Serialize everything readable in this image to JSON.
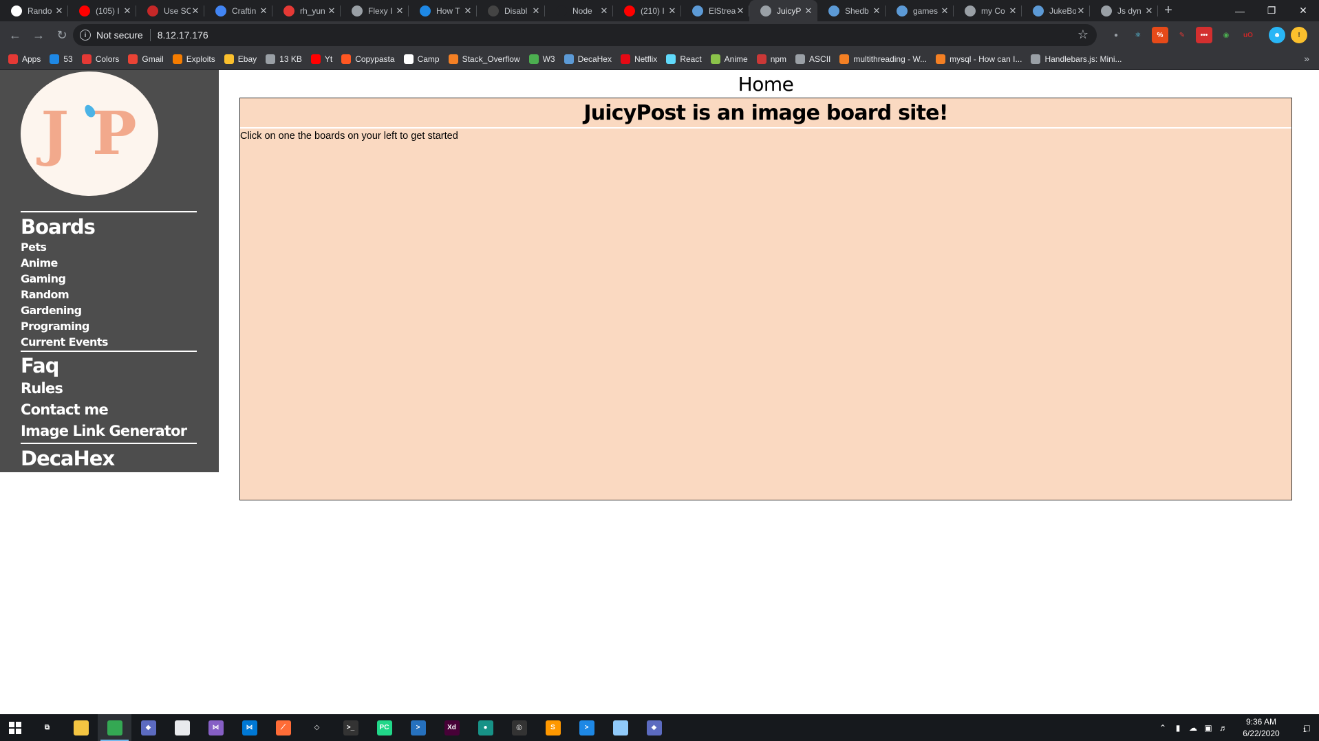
{
  "browser": {
    "tabs": [
      {
        "title": "Rando",
        "icon": "generic-icon",
        "color": "#ffffff"
      },
      {
        "title": "(105) I",
        "icon": "youtube-icon",
        "color": "#ff0000"
      },
      {
        "title": "Use SC",
        "icon": "shield-icon",
        "color": "#c62828"
      },
      {
        "title": "Craftin",
        "icon": "bracket-icon",
        "color": "#4285f4"
      },
      {
        "title": "rh_yun",
        "icon": "hat-icon",
        "color": "#e53935"
      },
      {
        "title": "Flexy I",
        "icon": "globe-icon",
        "color": "#9aa0a6"
      },
      {
        "title": "How T",
        "icon": "refresh-icon",
        "color": "#1e88e5"
      },
      {
        "title": "Disabl",
        "icon": "pin-icon",
        "color": "#444444"
      },
      {
        "title": "Node",
        "icon": "node-icon",
        "color": "#202124"
      },
      {
        "title": "(210) I",
        "icon": "youtube-icon",
        "color": "#ff0000"
      },
      {
        "title": "ElStrea",
        "icon": "monitor-icon",
        "color": "#5c9ad6"
      },
      {
        "title": "JuicyP",
        "icon": "globe-icon",
        "color": "#9aa0a6",
        "active": true
      },
      {
        "title": "Shedb",
        "icon": "monitor-icon",
        "color": "#5c9ad6"
      },
      {
        "title": "games",
        "icon": "monitor-icon",
        "color": "#5c9ad6"
      },
      {
        "title": "my Co",
        "icon": "globe-icon",
        "color": "#9aa0a6"
      },
      {
        "title": "JukeBo",
        "icon": "monitor-icon",
        "color": "#5c9ad6"
      },
      {
        "title": "Js dyn",
        "icon": "globe-icon",
        "color": "#9aa0a6"
      }
    ],
    "new_tab": "+",
    "address": {
      "security": "Not secure",
      "url": "8.12.17.176"
    },
    "bookmarks": [
      {
        "label": "Apps",
        "color": "#e53935"
      },
      {
        "label": "53",
        "color": "#1e88e5"
      },
      {
        "label": "Colors",
        "color": "#e53935"
      },
      {
        "label": "Gmail",
        "color": "#ea4335"
      },
      {
        "label": "Exploits",
        "color": "#f57c00"
      },
      {
        "label": "Ebay",
        "color": "#fbc02d"
      },
      {
        "label": "13 KB",
        "color": "#9aa0a6"
      },
      {
        "label": "Yt",
        "color": "#ff0000"
      },
      {
        "label": "Copypasta",
        "color": "#ff5722"
      },
      {
        "label": "Camp",
        "color": "#ffffff"
      },
      {
        "label": "Stack_Overflow",
        "color": "#f48024"
      },
      {
        "label": "W3",
        "color": "#4caf50"
      },
      {
        "label": "DecaHex",
        "color": "#5c9ad6"
      },
      {
        "label": "Netflix",
        "color": "#e50914"
      },
      {
        "label": "React",
        "color": "#61dafb"
      },
      {
        "label": "Anime",
        "color": "#8bc34a"
      },
      {
        "label": "npm",
        "color": "#cb3837"
      },
      {
        "label": "ASCII",
        "color": "#9aa0a6"
      },
      {
        "label": "multithreading - W...",
        "color": "#f48024"
      },
      {
        "label": "mysql - How can I...",
        "color": "#f48024"
      },
      {
        "label": "Handlebars.js: Mini...",
        "color": "#9aa0a6"
      }
    ]
  },
  "site": {
    "logo_text": "J P",
    "sections": {
      "boards_heading": "Boards",
      "boards": [
        "Pets",
        "Anime",
        "Gaming",
        "Random",
        "Gardening",
        "Programing",
        "Current Events"
      ],
      "faq_heading": "Faq",
      "links": [
        "Rules",
        "Contact me",
        "Image Link Generator"
      ],
      "footer_heading": "DecaHex"
    },
    "page_title": "Home",
    "main_heading": "JuicyPost is an image board site!",
    "main_text": "Click on one the boards on your left to get started",
    "colors": {
      "sidebar": "#4d4d4d",
      "panel": "#fad9c1",
      "logo": "#f2a98c"
    }
  },
  "taskbar": {
    "apps": [
      {
        "name": "task-view-icon",
        "color": "#16191d",
        "glyph": "⧉"
      },
      {
        "name": "file-explorer-icon",
        "color": "#f4c542",
        "glyph": ""
      },
      {
        "name": "chrome-icon",
        "color": "#34a853",
        "glyph": "",
        "active": true
      },
      {
        "name": "git-icon",
        "color": "#5c6bc0",
        "glyph": "◆"
      },
      {
        "name": "notepad-icon",
        "color": "#e8eaed",
        "glyph": ""
      },
      {
        "name": "visual-studio-icon",
        "color": "#865fc5",
        "glyph": "⋈"
      },
      {
        "name": "vscode-icon",
        "color": "#0078d4",
        "glyph": "⋈"
      },
      {
        "name": "postman-icon",
        "color": "#ff6c37",
        "glyph": "⟋"
      },
      {
        "name": "unity-icon",
        "color": "#16191d",
        "glyph": "◇"
      },
      {
        "name": "terminal-icon",
        "color": "#333333",
        "glyph": ">_"
      },
      {
        "name": "pycharm-icon",
        "color": "#21d789",
        "glyph": "PC"
      },
      {
        "name": "powershell-icon",
        "color": "#2671be",
        "glyph": ">"
      },
      {
        "name": "adobe-xd-icon",
        "color": "#470137",
        "glyph": "Xd"
      },
      {
        "name": "gitkraken-icon",
        "color": "#179287",
        "glyph": "●"
      },
      {
        "name": "davinci-icon",
        "color": "#333333",
        "glyph": "◎"
      },
      {
        "name": "sublime-icon",
        "color": "#ff9800",
        "glyph": "S"
      },
      {
        "name": "azure-icon",
        "color": "#1e88e5",
        "glyph": ">"
      },
      {
        "name": "docs-icon",
        "color": "#90caf9",
        "glyph": ""
      },
      {
        "name": "git-gui-icon",
        "color": "#5c6bc0",
        "glyph": "◆"
      }
    ],
    "time": "9:36 AM",
    "date": "6/22/2020",
    "notifications": "1"
  }
}
